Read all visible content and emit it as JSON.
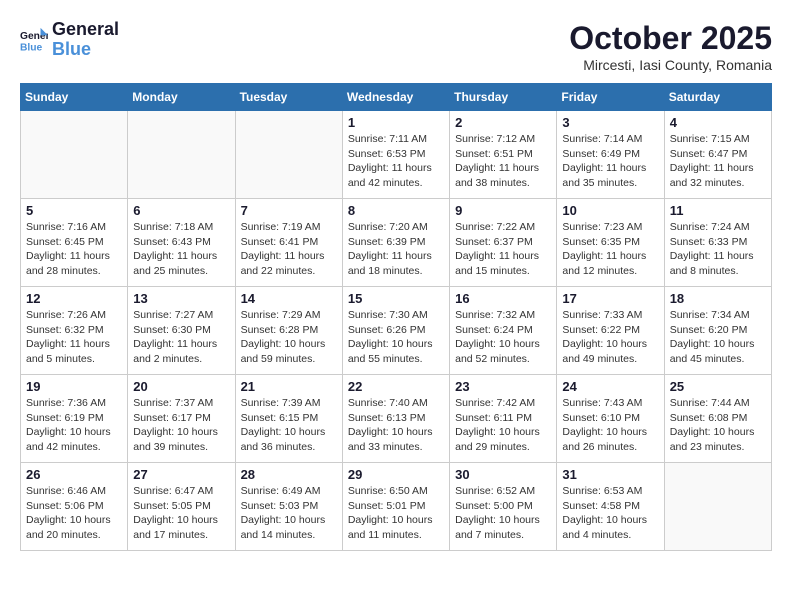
{
  "header": {
    "logo_line1": "General",
    "logo_line2": "Blue",
    "month": "October 2025",
    "location": "Mircesti, Iasi County, Romania"
  },
  "weekdays": [
    "Sunday",
    "Monday",
    "Tuesday",
    "Wednesday",
    "Thursday",
    "Friday",
    "Saturday"
  ],
  "weeks": [
    [
      {
        "day": "",
        "info": ""
      },
      {
        "day": "",
        "info": ""
      },
      {
        "day": "",
        "info": ""
      },
      {
        "day": "1",
        "info": "Sunrise: 7:11 AM\nSunset: 6:53 PM\nDaylight: 11 hours\nand 42 minutes."
      },
      {
        "day": "2",
        "info": "Sunrise: 7:12 AM\nSunset: 6:51 PM\nDaylight: 11 hours\nand 38 minutes."
      },
      {
        "day": "3",
        "info": "Sunrise: 7:14 AM\nSunset: 6:49 PM\nDaylight: 11 hours\nand 35 minutes."
      },
      {
        "day": "4",
        "info": "Sunrise: 7:15 AM\nSunset: 6:47 PM\nDaylight: 11 hours\nand 32 minutes."
      }
    ],
    [
      {
        "day": "5",
        "info": "Sunrise: 7:16 AM\nSunset: 6:45 PM\nDaylight: 11 hours\nand 28 minutes."
      },
      {
        "day": "6",
        "info": "Sunrise: 7:18 AM\nSunset: 6:43 PM\nDaylight: 11 hours\nand 25 minutes."
      },
      {
        "day": "7",
        "info": "Sunrise: 7:19 AM\nSunset: 6:41 PM\nDaylight: 11 hours\nand 22 minutes."
      },
      {
        "day": "8",
        "info": "Sunrise: 7:20 AM\nSunset: 6:39 PM\nDaylight: 11 hours\nand 18 minutes."
      },
      {
        "day": "9",
        "info": "Sunrise: 7:22 AM\nSunset: 6:37 PM\nDaylight: 11 hours\nand 15 minutes."
      },
      {
        "day": "10",
        "info": "Sunrise: 7:23 AM\nSunset: 6:35 PM\nDaylight: 11 hours\nand 12 minutes."
      },
      {
        "day": "11",
        "info": "Sunrise: 7:24 AM\nSunset: 6:33 PM\nDaylight: 11 hours\nand 8 minutes."
      }
    ],
    [
      {
        "day": "12",
        "info": "Sunrise: 7:26 AM\nSunset: 6:32 PM\nDaylight: 11 hours\nand 5 minutes."
      },
      {
        "day": "13",
        "info": "Sunrise: 7:27 AM\nSunset: 6:30 PM\nDaylight: 11 hours\nand 2 minutes."
      },
      {
        "day": "14",
        "info": "Sunrise: 7:29 AM\nSunset: 6:28 PM\nDaylight: 10 hours\nand 59 minutes."
      },
      {
        "day": "15",
        "info": "Sunrise: 7:30 AM\nSunset: 6:26 PM\nDaylight: 10 hours\nand 55 minutes."
      },
      {
        "day": "16",
        "info": "Sunrise: 7:32 AM\nSunset: 6:24 PM\nDaylight: 10 hours\nand 52 minutes."
      },
      {
        "day": "17",
        "info": "Sunrise: 7:33 AM\nSunset: 6:22 PM\nDaylight: 10 hours\nand 49 minutes."
      },
      {
        "day": "18",
        "info": "Sunrise: 7:34 AM\nSunset: 6:20 PM\nDaylight: 10 hours\nand 45 minutes."
      }
    ],
    [
      {
        "day": "19",
        "info": "Sunrise: 7:36 AM\nSunset: 6:19 PM\nDaylight: 10 hours\nand 42 minutes."
      },
      {
        "day": "20",
        "info": "Sunrise: 7:37 AM\nSunset: 6:17 PM\nDaylight: 10 hours\nand 39 minutes."
      },
      {
        "day": "21",
        "info": "Sunrise: 7:39 AM\nSunset: 6:15 PM\nDaylight: 10 hours\nand 36 minutes."
      },
      {
        "day": "22",
        "info": "Sunrise: 7:40 AM\nSunset: 6:13 PM\nDaylight: 10 hours\nand 33 minutes."
      },
      {
        "day": "23",
        "info": "Sunrise: 7:42 AM\nSunset: 6:11 PM\nDaylight: 10 hours\nand 29 minutes."
      },
      {
        "day": "24",
        "info": "Sunrise: 7:43 AM\nSunset: 6:10 PM\nDaylight: 10 hours\nand 26 minutes."
      },
      {
        "day": "25",
        "info": "Sunrise: 7:44 AM\nSunset: 6:08 PM\nDaylight: 10 hours\nand 23 minutes."
      }
    ],
    [
      {
        "day": "26",
        "info": "Sunrise: 6:46 AM\nSunset: 5:06 PM\nDaylight: 10 hours\nand 20 minutes."
      },
      {
        "day": "27",
        "info": "Sunrise: 6:47 AM\nSunset: 5:05 PM\nDaylight: 10 hours\nand 17 minutes."
      },
      {
        "day": "28",
        "info": "Sunrise: 6:49 AM\nSunset: 5:03 PM\nDaylight: 10 hours\nand 14 minutes."
      },
      {
        "day": "29",
        "info": "Sunrise: 6:50 AM\nSunset: 5:01 PM\nDaylight: 10 hours\nand 11 minutes."
      },
      {
        "day": "30",
        "info": "Sunrise: 6:52 AM\nSunset: 5:00 PM\nDaylight: 10 hours\nand 7 minutes."
      },
      {
        "day": "31",
        "info": "Sunrise: 6:53 AM\nSunset: 4:58 PM\nDaylight: 10 hours\nand 4 minutes."
      },
      {
        "day": "",
        "info": ""
      }
    ]
  ]
}
